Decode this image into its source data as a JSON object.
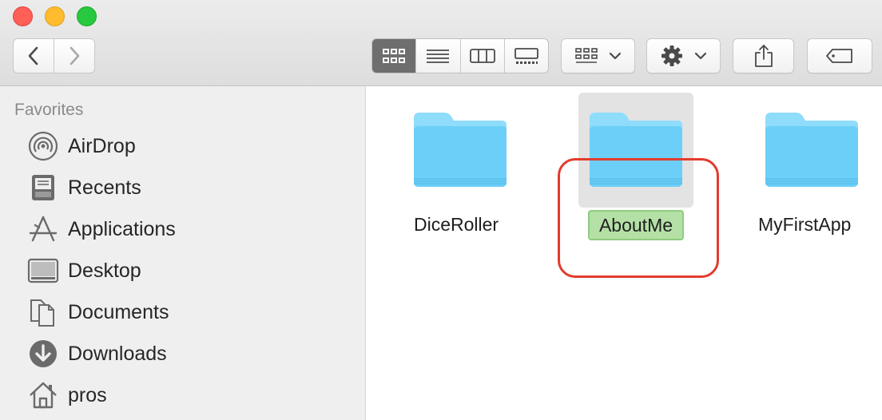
{
  "window": {
    "controls": [
      "close",
      "minimize",
      "zoom"
    ]
  },
  "toolbar": {
    "nav": [
      "back",
      "forward"
    ],
    "view_modes": [
      "icon-view",
      "list-view",
      "column-view",
      "gallery-view"
    ],
    "active_view": "icon-view",
    "group_menu": "group-by",
    "action_menu": "action",
    "share": "share",
    "tags": "tags"
  },
  "sidebar": {
    "heading": "Favorites",
    "items": [
      {
        "label": "AirDrop",
        "icon": "airdrop-icon"
      },
      {
        "label": "Recents",
        "icon": "recents-icon"
      },
      {
        "label": "Applications",
        "icon": "applications-icon"
      },
      {
        "label": "Desktop",
        "icon": "desktop-icon"
      },
      {
        "label": "Documents",
        "icon": "documents-icon"
      },
      {
        "label": "Downloads",
        "icon": "downloads-icon"
      },
      {
        "label": "pros",
        "icon": "home-icon"
      }
    ]
  },
  "content": {
    "folders": [
      {
        "name": "DiceRoller",
        "selected": false
      },
      {
        "name": "AboutMe",
        "selected": true,
        "renaming": true
      },
      {
        "name": "MyFirstApp",
        "selected": false
      }
    ]
  },
  "colors": {
    "folder_body": "#6ccff8",
    "folder_tab": "#8fdcfb",
    "rename_highlight": "#b4e0a6",
    "annotation_ring": "#e33b2e"
  }
}
